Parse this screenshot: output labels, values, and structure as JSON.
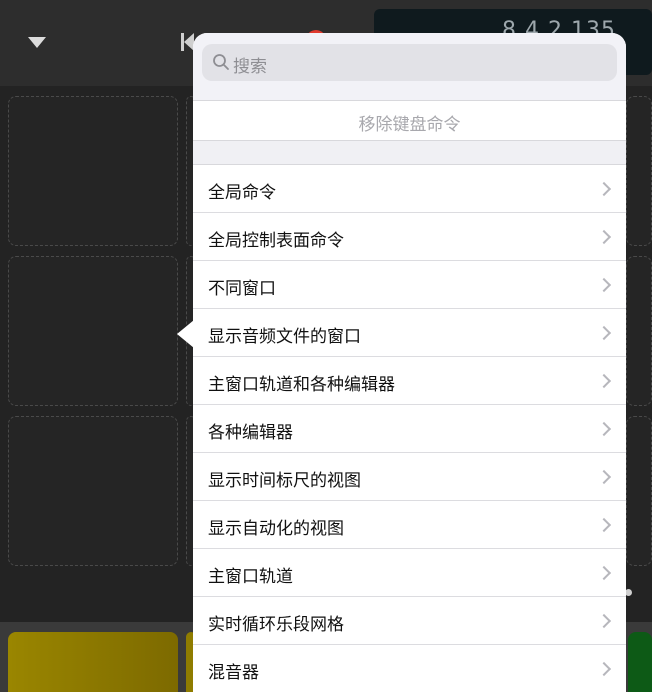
{
  "toolbar": {
    "lcd_display": "8 4 2 135",
    "icons": [
      "disclosure-triangle-icon",
      "rewind-icon",
      "record-icon"
    ]
  },
  "popover": {
    "search": {
      "placeholder": "搜索",
      "value": ""
    },
    "remove_command_label": "移除键盘命令",
    "items": [
      {
        "label": "全局命令"
      },
      {
        "label": "全局控制表面命令"
      },
      {
        "label": "不同窗口"
      },
      {
        "label": "显示音频文件的窗口"
      },
      {
        "label": "主窗口轨道和各种编辑器"
      },
      {
        "label": "各种编辑器"
      },
      {
        "label": "显示时间标尺的视图"
      },
      {
        "label": "显示自动化的视图"
      },
      {
        "label": "主窗口轨道"
      },
      {
        "label": "实时循环乐段网格"
      },
      {
        "label": "混音器"
      }
    ]
  },
  "colors": {
    "record": "#e03a2e",
    "cell_yellow": "#9a8600",
    "cell_green": "#0d5a16",
    "chevron": "#b7b7bc",
    "muted_text": "#a8a8ad"
  }
}
